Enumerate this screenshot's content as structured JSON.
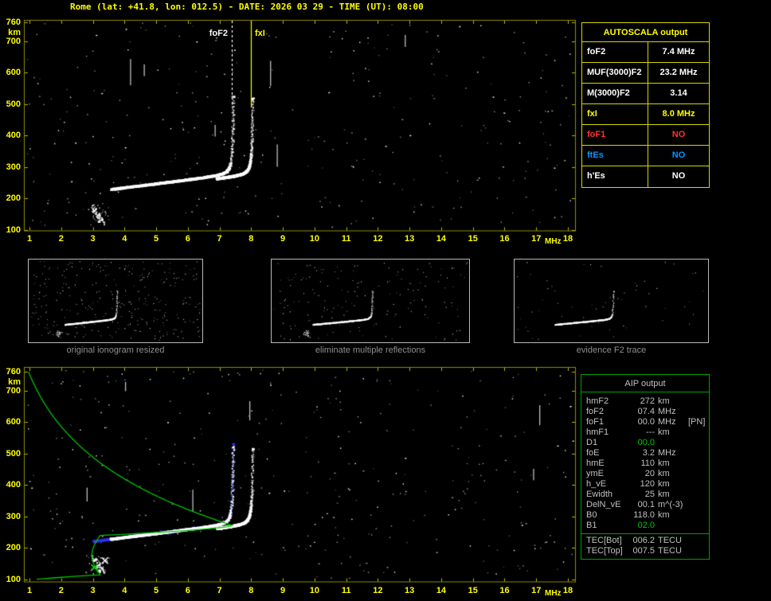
{
  "title": "Rome (lat: +41.8, lon: 012.5) - DATE: 2026 03 29 - TIME (UT): 08:00",
  "colors": {
    "background": "#000000",
    "title_yellow": "#ffff00",
    "plot_border": "#8f8f00",
    "axis_labels": "#ffff00",
    "trace_white": "#ffffff",
    "profile_green": "#00c400",
    "fit_blue": "#3333ee",
    "autoscala_border": "#d6d600",
    "aip_border": "#00a000",
    "aip_text": "#c0c0c0",
    "green_value": "#00c800",
    "caption_gray": "#8f8f8f",
    "value_red": "#ff3232",
    "value_blue": "#0096ff"
  },
  "axes": {
    "x_unit": "MHz",
    "y_unit": "km",
    "x_min": 1,
    "x_max": 18,
    "y_min": 100,
    "y_max": 760,
    "x_ticks": [
      "1",
      "2",
      "3",
      "4",
      "5",
      "6",
      "7",
      "8",
      "9",
      "10",
      "11",
      "12",
      "13",
      "14",
      "15",
      "16",
      "17",
      "18"
    ],
    "y_ticks": [
      "760",
      "700",
      "600",
      "500",
      "400",
      "300",
      "200",
      "100"
    ]
  },
  "top_plot": {
    "fof2_marker": {
      "label": "foF2",
      "mhz": 7.4
    },
    "fxi_marker": {
      "label": "fxI",
      "mhz": 8.0
    }
  },
  "ionogram": {
    "fof2_mhz": 7.4,
    "fxi_mhz": 8.0,
    "hmf2_km": 272,
    "foe_mhz": 3.2,
    "hme_km": 110,
    "trace_start_mhz": 3.55,
    "trace_start_km": 230,
    "es_cluster": {
      "mhz": 3.2,
      "km": 150
    }
  },
  "autoscala_table": {
    "header": "AUTOSCALA output",
    "rows": [
      {
        "param": "foF2",
        "value": "7.4 MHz",
        "color": "#ffffff"
      },
      {
        "param": "MUF(3000)F2",
        "value": "23.2 MHz",
        "color": "#ffffff"
      },
      {
        "param": "M(3000)F2",
        "value": "3.14",
        "color": "#ffffff"
      },
      {
        "param": "fxI",
        "value": "8.0 MHz",
        "color": "#ffff00"
      },
      {
        "param": "foF1",
        "value": "NO",
        "color": "#ff3232"
      },
      {
        "param": "ftEs",
        "value": "NO",
        "color": "#0096ff"
      },
      {
        "param": "h'Es",
        "value": "NO",
        "color": "#ffffff"
      }
    ]
  },
  "thumbnails": [
    {
      "caption": "original ionogram resized"
    },
    {
      "caption": "eliminate multiple reflections"
    },
    {
      "caption": "evidence F2 trace"
    }
  ],
  "aip_table": {
    "header": "AIP output",
    "rows": [
      {
        "param": "hmF2",
        "value": "272",
        "unit": "km",
        "note": "",
        "highlight": false
      },
      {
        "param": "foF2",
        "value": "07.4",
        "unit": "MHz",
        "note": "",
        "highlight": false
      },
      {
        "param": "foF1",
        "value": "00.0",
        "unit": "MHz",
        "note": "[PN]",
        "highlight": false
      },
      {
        "param": "hmF1",
        "value": "---",
        "unit": "km",
        "note": "",
        "highlight": false
      },
      {
        "param": "D1",
        "value": "00.0",
        "unit": "",
        "note": "",
        "highlight": true
      },
      {
        "param": "foE",
        "value": "3.2",
        "unit": "MHz",
        "note": "",
        "highlight": false
      },
      {
        "param": "hmE",
        "value": "110",
        "unit": "km",
        "note": "",
        "highlight": false
      },
      {
        "param": "ymE",
        "value": "20",
        "unit": "km",
        "note": "",
        "highlight": false
      },
      {
        "param": "h_vE",
        "value": "120",
        "unit": "km",
        "note": "",
        "highlight": false
      },
      {
        "param": "Ewidth",
        "value": "25",
        "unit": "km",
        "note": "",
        "highlight": false
      },
      {
        "param": "DelN_vE",
        "value": "00.1",
        "unit": "m^(-3)",
        "note": "",
        "highlight": false
      },
      {
        "param": "B0",
        "value": "118.0",
        "unit": "km",
        "note": "",
        "highlight": false
      },
      {
        "param": "B1",
        "value": "02.0",
        "unit": "",
        "note": "",
        "highlight": true
      }
    ],
    "tec_rows": [
      {
        "param": "TEC[Bot]",
        "value": "006.2",
        "unit": "TECU"
      },
      {
        "param": "TEC[Top]",
        "value": "007.5",
        "unit": "TECU"
      }
    ]
  }
}
